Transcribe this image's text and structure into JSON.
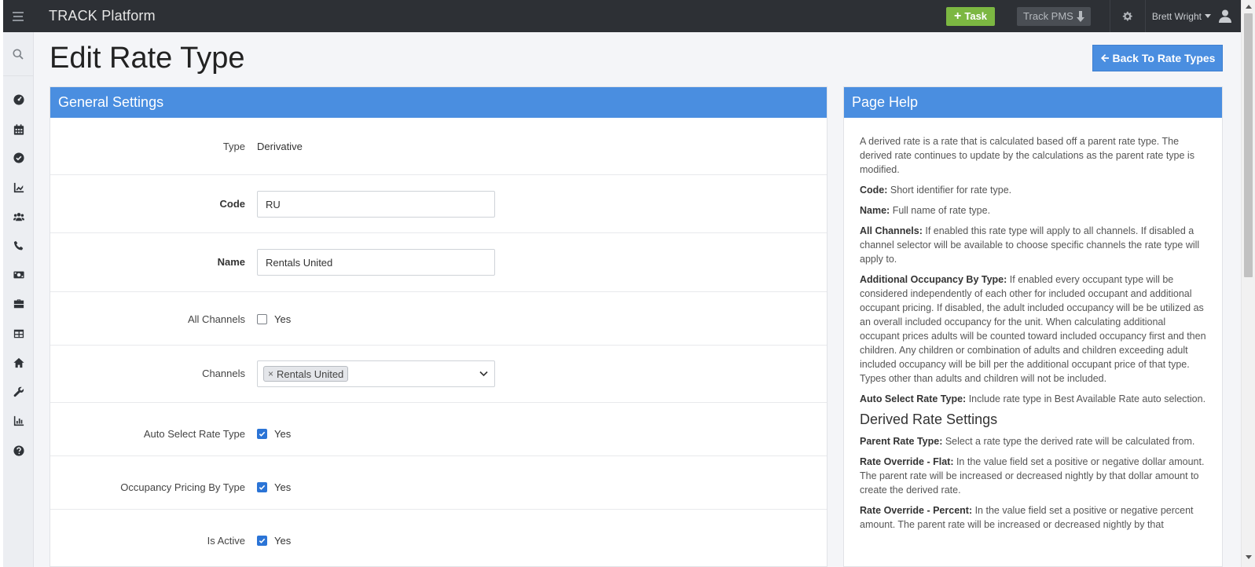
{
  "topbar": {
    "brand": "TRACK Platform",
    "task_button": "Task",
    "pms_button": "Track PMS",
    "user_name": "Brett Wright"
  },
  "sidebar": {
    "items": [
      "search-icon",
      "dashboard-icon",
      "calendar-icon",
      "check-circle-icon",
      "chart-icon",
      "users-icon",
      "phone-icon",
      "money-icon",
      "briefcase-icon",
      "grid-icon",
      "home-icon",
      "wrench-icon",
      "report-icon",
      "help-icon"
    ]
  },
  "page": {
    "title": "Edit Rate Type",
    "back_button": "Back To Rate Types"
  },
  "general": {
    "heading": "General Settings",
    "type_label": "Type",
    "type_value": "Derivative",
    "code_label": "Code",
    "code_value": "RU",
    "name_label": "Name",
    "name_value": "Rentals United",
    "all_channels_label": "All Channels",
    "all_channels_checked": false,
    "yes": "Yes",
    "channels_label": "Channels",
    "channels_selected": [
      "Rentals United"
    ],
    "auto_select_label": "Auto Select Rate Type",
    "auto_select_checked": true,
    "occupancy_label": "Occupancy Pricing By Type",
    "occupancy_checked": true,
    "active_label": "Is Active",
    "active_checked": true
  },
  "help": {
    "heading": "Page Help",
    "intro": "A derived rate is a rate that is calculated based off a parent rate type. The derived rate continues to update by the calculations as the parent rate type is modified.",
    "code_term": "Code:",
    "code_text": " Short identifier for rate type.",
    "name_term": "Name:",
    "name_text": " Full name of rate type.",
    "channels_term": "All Channels:",
    "channels_text": " If enabled this rate type will apply to all channels. If disabled a channel selector will be available to choose specific channels the rate type will apply to.",
    "occupancy_term": "Additional Occupancy By Type:",
    "occupancy_text": " If enabled every occupant type will be considered independently of each other for included occupant and additional occupant pricing. If disabled, the adult included occupancy will be be utilized as an overall included occupancy for the unit. When calculating additional occupant prices adults will be counted toward included occupancy first and then children. Any children or combination of adults and children exceeding adult included occupancy will be bill per the additional occupant price of that type. Types other than adults and children will not be included.",
    "auto_term": "Auto Select Rate Type:",
    "auto_text": " Include rate type in Best Available Rate auto selection.",
    "derived_heading": "Derived Rate Settings",
    "parent_term": "Parent Rate Type:",
    "parent_text": " Select a rate type the derived rate will be calculated from.",
    "flat_term": "Rate Override - Flat:",
    "flat_text": " In the value field set a positive or negative dollar amount. The parent rate will be increased or decreased nightly by that dollar amount to create the derived rate.",
    "percent_term": "Rate Override - Percent:",
    "percent_text": " In the value field set a positive or negative percent amount. The parent rate will be increased or decreased nightly by that"
  },
  "colors": {
    "topbar": "#2d3035",
    "accent_blue": "#4a8ee0",
    "task_green": "#7cb742",
    "checkbox_blue": "#2b74d6"
  }
}
